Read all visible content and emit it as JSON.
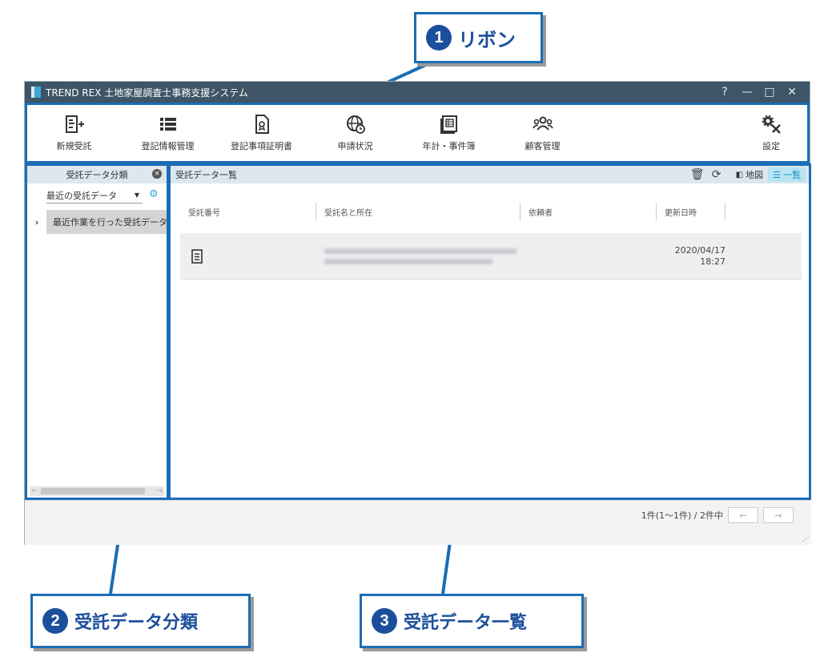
{
  "callouts": [
    {
      "num": "1",
      "label": "リボン"
    },
    {
      "num": "2",
      "label": "受託データ分類"
    },
    {
      "num": "3",
      "label": "受託データ一覧"
    }
  ],
  "window": {
    "title": "TREND REX 土地家屋調査士事務支援システム",
    "controls": {
      "help": "?",
      "minimize": "—",
      "maximize": "□",
      "close": "✕"
    }
  },
  "ribbon": {
    "items": [
      {
        "label": "新規受託",
        "icon": "new-document-plus-icon"
      },
      {
        "label": "登記情報管理",
        "icon": "list-icon"
      },
      {
        "label": "登記事項証明書",
        "icon": "certificate-icon"
      },
      {
        "label": "申請状況",
        "icon": "globe-clock-icon"
      },
      {
        "label": "年計・事件簿",
        "icon": "ledger-icon"
      },
      {
        "label": "顧客管理",
        "icon": "people-icon"
      },
      {
        "label": "設定",
        "icon": "gear-tools-icon"
      }
    ]
  },
  "left_pane": {
    "header": "受託データ分類",
    "select_value": "最近の受託データ",
    "tree_item": "最近作業を行った受託データ"
  },
  "right_pane": {
    "header": "受託データ一覧",
    "map_label": "地図",
    "list_label": "一覧",
    "columns": [
      "受託番号",
      "受託名と所在",
      "依頼者",
      "更新日時"
    ],
    "rows": [
      {
        "date": "2020/04/17",
        "time": "18:27"
      }
    ]
  },
  "pager": {
    "text": "1件(1〜1件) / 2件中",
    "prev": "←",
    "next": "→"
  },
  "colors": {
    "accent": "#1b6db5",
    "badge": "#1b4f9c",
    "titlebar": "#3d5566",
    "pane_header": "#dce7f0",
    "list_active": "#b8e3f2"
  }
}
